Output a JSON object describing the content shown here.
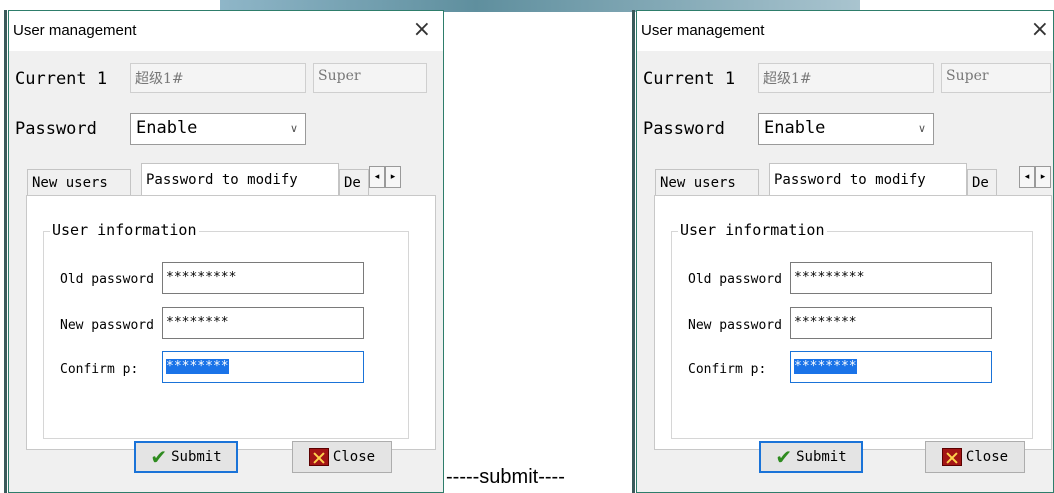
{
  "caption": "-----submit----",
  "dialogs": [
    {
      "title": "User management",
      "current_label": "Current 1",
      "current_user": "超级1#",
      "current_role": "Super",
      "password_label": "Password",
      "password_mode": "Enable",
      "tabs": [
        "New users",
        "Password to modify",
        "De"
      ],
      "group_title": "User information",
      "fields": [
        {
          "label": "Old password",
          "value": "*********"
        },
        {
          "label": "New password",
          "value": "********"
        },
        {
          "label": "Confirm p:",
          "value": "********"
        }
      ],
      "submit_label": "Submit",
      "close_label": "Close"
    },
    {
      "title": "User management",
      "current_label": "Current 1",
      "current_user": "超级1#",
      "current_role": "Super",
      "password_label": "Password",
      "password_mode": "Enable",
      "tabs": [
        "New users",
        "Password to modify",
        "De"
      ],
      "group_title": "User information",
      "fields": [
        {
          "label": "Old password",
          "value": "*********"
        },
        {
          "label": "New password",
          "value": "********"
        },
        {
          "label": "Confirm p:",
          "value": "********"
        }
      ],
      "submit_label": "Submit",
      "close_label": "Close"
    }
  ],
  "icons": {
    "close_x": "×",
    "chevron": "∨",
    "arrow_left": "◂",
    "arrow_right": "▸",
    "submit": "check-icon",
    "close": "close-icon"
  }
}
